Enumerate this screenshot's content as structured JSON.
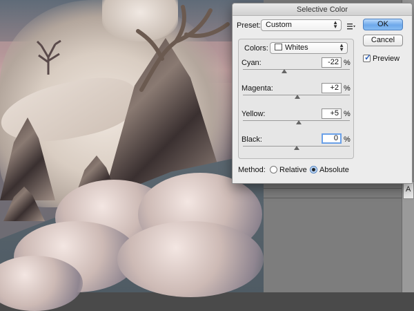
{
  "dialog": {
    "title": "Selective Color",
    "preset": {
      "label": "Preset:",
      "value": "Custom",
      "menu_icon": "list-menu-icon"
    },
    "colors": {
      "label": "Colors:",
      "value": "Whites"
    },
    "sliders": [
      {
        "label": "Cyan:",
        "value": "-22",
        "unit": "%",
        "fraction": 0.39
      },
      {
        "label": "Magenta:",
        "value": "+2",
        "unit": "%",
        "fraction": 0.51
      },
      {
        "label": "Yellow:",
        "value": "+5",
        "unit": "%",
        "fraction": 0.525
      },
      {
        "label": "Black:",
        "value": "0",
        "unit": "%",
        "fraction": 0.5
      }
    ],
    "method": {
      "label": "Method:",
      "options": [
        "Relative",
        "Absolute"
      ],
      "selected": "Absolute"
    },
    "buttons": {
      "ok": "OK",
      "cancel": "Cancel"
    },
    "preview": {
      "label": "Preview",
      "checked": true
    }
  },
  "panel": {
    "edge_glyph": "A"
  },
  "colors": {
    "accent": "#6ea9ea",
    "dialog_bg": "#ececec"
  }
}
